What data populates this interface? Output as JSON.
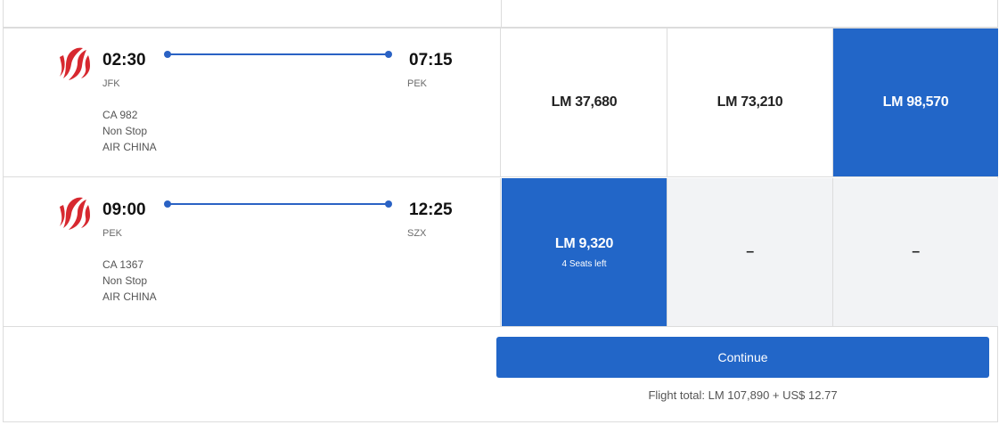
{
  "colors": {
    "accent": "#2266c8",
    "logo_red": "#d7282f",
    "unavailable_bg": "#f2f3f5"
  },
  "flights": [
    {
      "logo_icon": "air-china-logo-icon",
      "departure_time": "02:30",
      "departure_code": "JFK",
      "arrival_time": "07:15",
      "arrival_code": "PEK",
      "flight_number": "CA 982",
      "stops": "Non Stop",
      "airline": "AIR CHINA",
      "fares": [
        {
          "price": "LM 37,680",
          "seats": "",
          "state": "plain"
        },
        {
          "price": "LM 73,210",
          "seats": "",
          "state": "plain"
        },
        {
          "price": "LM 98,570",
          "seats": "",
          "state": "selected"
        }
      ]
    },
    {
      "logo_icon": "air-china-logo-icon",
      "departure_time": "09:00",
      "departure_code": "PEK",
      "arrival_time": "12:25",
      "arrival_code": "SZX",
      "flight_number": "CA 1367",
      "stops": "Non Stop",
      "airline": "AIR CHINA",
      "fares": [
        {
          "price": "LM 9,320",
          "seats": "4 Seats left",
          "state": "selected"
        },
        {
          "price": "–",
          "seats": "",
          "state": "unavailable"
        },
        {
          "price": "–",
          "seats": "",
          "state": "unavailable"
        }
      ]
    }
  ],
  "continue_label": "Continue",
  "flight_total": "Flight total: LM 107,890 + US$ 12.77"
}
